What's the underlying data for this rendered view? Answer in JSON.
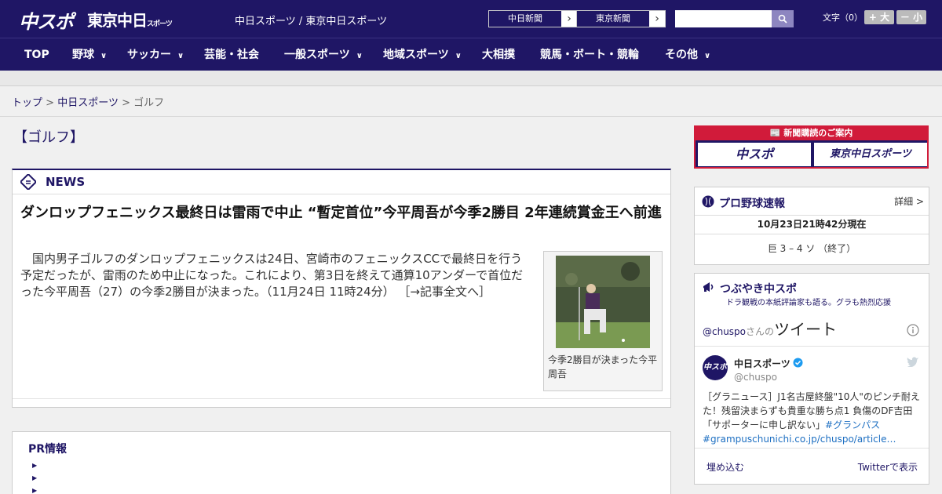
{
  "header": {
    "logo1": "中スポ",
    "logo2": "東京中日",
    "logo2_small": "スポーツ",
    "site_title": "中日スポーツ / 東京中日スポーツ",
    "paper_links": [
      "中日新聞",
      "東京新聞"
    ],
    "search_placeholder": "",
    "font_size_label": "文字（0）",
    "font_bigger": "+ 大",
    "font_smaller": "－ 小"
  },
  "nav": {
    "items": [
      {
        "label": "TOP",
        "has_menu": false
      },
      {
        "label": "野球",
        "has_menu": true
      },
      {
        "label": "サッカー",
        "has_menu": true
      },
      {
        "label": "芸能・社会",
        "has_menu": false
      },
      {
        "label": "一般スポーツ",
        "has_menu": true
      },
      {
        "label": "地域スポーツ",
        "has_menu": true
      },
      {
        "label": "大相撲",
        "has_menu": false
      },
      {
        "label": "競馬・ボート・競輪",
        "has_menu": false
      },
      {
        "label": "その他",
        "has_menu": true
      }
    ]
  },
  "breadcrumb": {
    "top": "トップ",
    "sep": ">",
    "section": "中日スポーツ",
    "current": "ゴルフ"
  },
  "section_title": "【ゴルフ】",
  "news": {
    "label": "NEWS",
    "headline": "ダンロップフェニックス最終日は雷雨で中止 “暫定首位”今平周吾が今季2勝目 2年連続賞金王へ前進",
    "body": "国内男子ゴルフのダンロップフェニックスは24日、宮崎市のフェニックスCCで最終日を行う予定だったが、雷雨のため中止になった。これにより、第3日を終えて通算10アンダーで首位だった今平周吾（27）の今季2勝目が決まった。（11月24日 11時24分） ［→記事全文へ］",
    "photo_caption": "今季2勝目が決まった今平周吾"
  },
  "pr": {
    "title": "PR情報"
  },
  "sidebar": {
    "subscribe_head": "新聞購読のご案内",
    "subscribe_buttons": [
      "中スポ",
      "東京中日スポーツ"
    ],
    "baseball": {
      "title": "プロ野球速報",
      "detail": "詳細 >",
      "timestamp": "10月23日21時42分現在",
      "score": "巨 3 – 4 ソ （終了）"
    },
    "tweets": {
      "title": "つぶやき中スポ",
      "subtitle": "ドラ観戦の本紙評論家も語る。グラも熱烈応援",
      "handle_prefix": "@chuspo",
      "handle_suffix": "さんの",
      "tweets_word": "ツイート",
      "account_name": "中日スポーツ",
      "account_handle": "@chuspo",
      "tweet_text": "［グラニュース］J1名古屋終盤\"10人\"のピンチ耐えた！残留決まらずも貴重な勝ち点1 負傷のDF吉田「サポーターに申し訳ない」",
      "tweet_hashtag": "#グランパス",
      "tweet_link": "#grampuschunichi.co.jp/chuspo/article…",
      "embed_label": "埋め込む",
      "view_label": "Twitterで表示"
    }
  },
  "colors": {
    "brand": "#1f1665",
    "accent_red": "#d11b3a"
  }
}
